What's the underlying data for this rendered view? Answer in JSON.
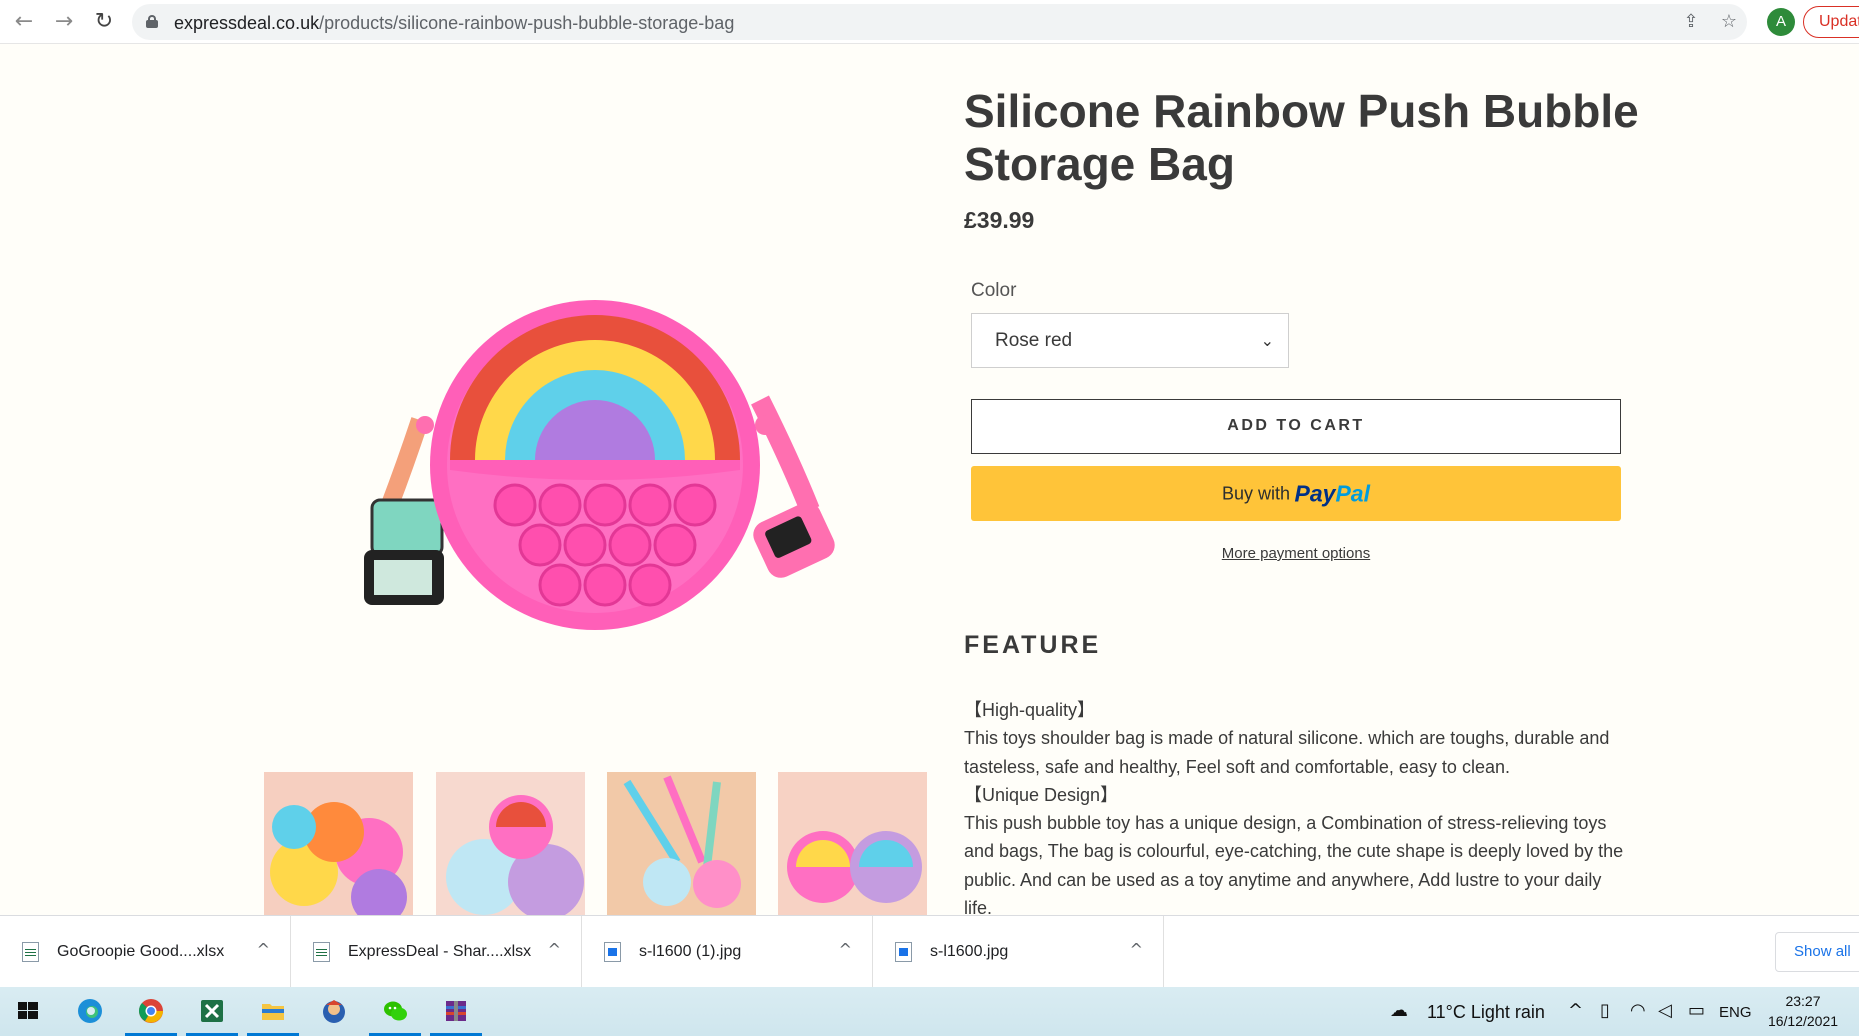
{
  "browser": {
    "url_host": "expressdeal.co.uk",
    "url_path": "/products/silicone-rainbow-push-bubble-storage-bag",
    "profile_initial": "A",
    "update_label": "Updat"
  },
  "product": {
    "title": "Silicone Rainbow Push Bubble Storage Bag",
    "price": "£39.99",
    "color_label": "Color",
    "color_selected": "Rose red",
    "add_to_cart": "ADD TO CART",
    "paypal_prefix": "Buy with",
    "paypal_pay": "Pay",
    "paypal_pal": "Pal",
    "more_payment": "More payment options",
    "feature_heading": "FEATURE",
    "description": [
      "【High-quality】",
      "This toys shoulder bag is made of natural silicone. which are toughs, durable and tasteless, safe and healthy, Feel soft and comfortable, easy to clean.",
      "【Unique Design】",
      "This push bubble toy has a unique design, a Combination of stress-relieving toys and bags, The bag is colourful, eye-catching, the cute shape is deeply loved by the public. And can be used as a toy anytime and anywhere, Add lustre to your daily life."
    ]
  },
  "downloads": {
    "items": [
      {
        "name": "GoGroopie Good....xlsx",
        "type": "xls"
      },
      {
        "name": "ExpressDeal - Shar....xlsx",
        "type": "xls"
      },
      {
        "name": "s-l1600 (1).jpg",
        "type": "img"
      },
      {
        "name": "s-l1600.jpg",
        "type": "img"
      }
    ],
    "show_all": "Show all"
  },
  "taskbar": {
    "weather": "11°C  Light rain",
    "language": "ENG",
    "time": "23:27",
    "date": "16/12/2021"
  },
  "colors": {
    "paypal_yellow": "#ffc439",
    "bag_pink": "#ff5fb8",
    "accent_blue": "#0078d4"
  }
}
